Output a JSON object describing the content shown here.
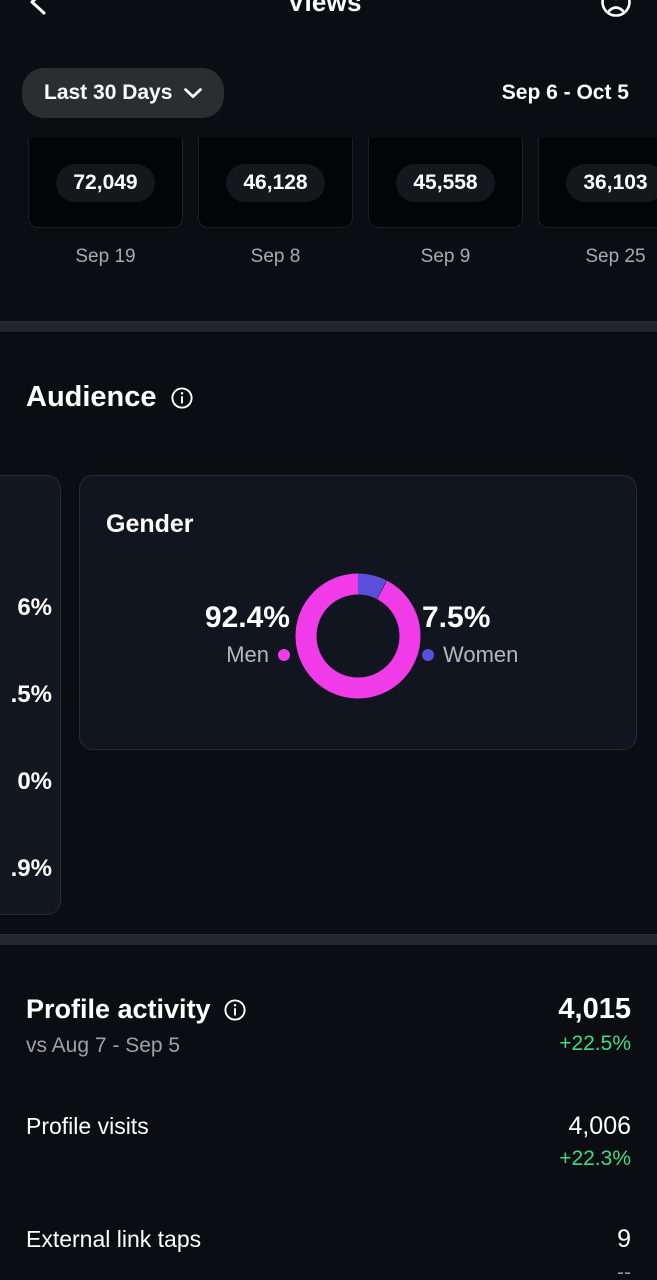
{
  "navbar": {
    "back_icon": "chevron-left-icon",
    "title": "Views",
    "right_icon": "account-info-circle-icon"
  },
  "date_controls": {
    "range_label": "Last 30 Days",
    "chevron_icon": "chevron-down-icon",
    "date_range": "Sep 6 - Oct 5"
  },
  "top_content": {
    "items": [
      {
        "views": "72,049",
        "date": "Sep 19"
      },
      {
        "views": "46,128",
        "date": "Sep 8"
      },
      {
        "views": "45,558",
        "date": "Sep 9"
      },
      {
        "views": "36,103",
        "date": "Sep 25"
      }
    ]
  },
  "audience": {
    "title": "Audience",
    "info_icon": "info-circle-icon",
    "age_card": {
      "percentages": [
        "6%",
        ".5%",
        "0%",
        ".9%"
      ]
    },
    "gender_card": {
      "title": "Gender",
      "men_pct": "92.4%",
      "men_label": "Men",
      "men_color": "#f23be8",
      "women_pct": "7.5%",
      "women_label": "Women",
      "women_color": "#5a4fdb"
    }
  },
  "chart_data": {
    "type": "pie",
    "title": "Gender",
    "categories": [
      "Men",
      "Women"
    ],
    "values": [
      92.4,
      7.5
    ],
    "colors": [
      "#f23be8",
      "#5a4fdb"
    ],
    "labels": [
      "92.4%",
      "7.5%"
    ],
    "legend": "sides",
    "donut": true
  },
  "profile_activity": {
    "title": "Profile activity",
    "info_icon": "info-circle-icon",
    "subtitle": "vs Aug 7 - Sep 5",
    "total": "4,015",
    "delta": "+22.5%",
    "rows": [
      {
        "label": "Profile visits",
        "value": "4,006",
        "delta": "+22.3%",
        "delta_muted": false
      },
      {
        "label": "External link taps",
        "value": "9",
        "delta": "--",
        "delta_muted": true
      }
    ]
  }
}
